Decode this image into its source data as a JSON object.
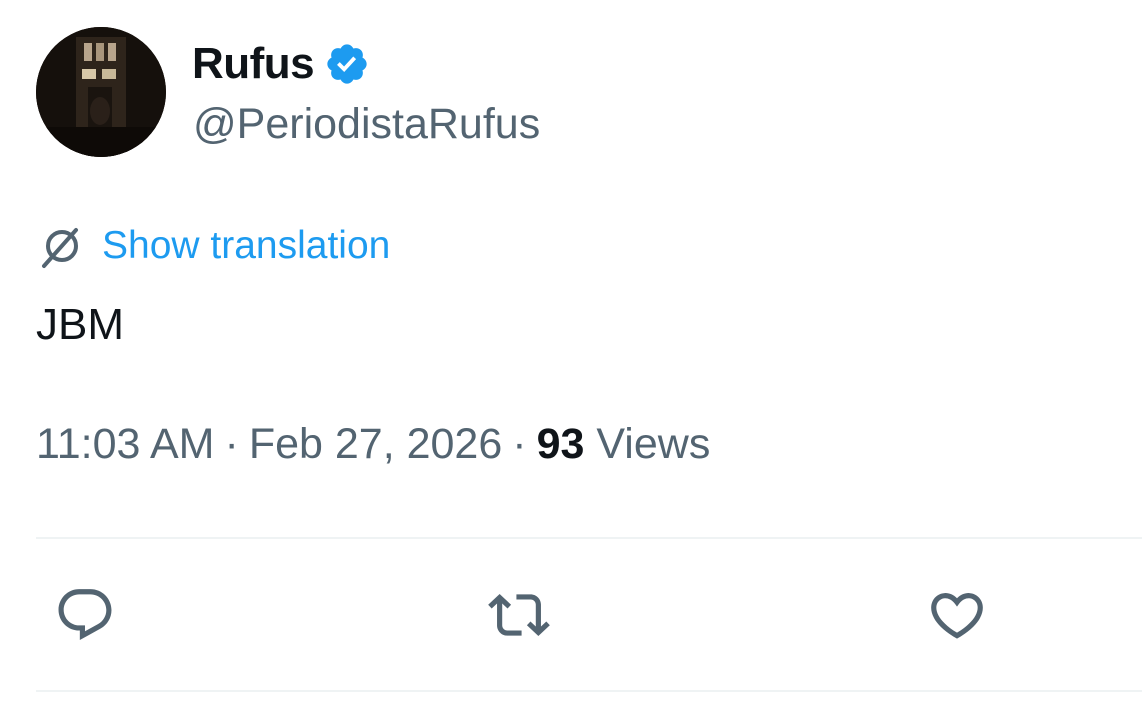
{
  "author": {
    "display_name": "Rufus",
    "handle": "@PeriodistaRufus",
    "verified": true,
    "verified_color": "#1d9bf0",
    "avatar_icon": "profile-avatar"
  },
  "translation": {
    "link_label": "Show translation",
    "icon": "translate-icon",
    "color": "#1d9bf0"
  },
  "tweet": {
    "text": "JBM"
  },
  "meta": {
    "time": "11:03 AM",
    "separator": "·",
    "date": "Feb 27, 2026",
    "views_count": "93",
    "views_label": "Views"
  },
  "actions": [
    {
      "name": "reply",
      "icon": "reply-icon"
    },
    {
      "name": "retweet",
      "icon": "retweet-icon"
    },
    {
      "name": "like",
      "icon": "heart-icon"
    }
  ],
  "colors": {
    "text_primary": "#0f1419",
    "text_secondary": "#536471",
    "accent": "#1d9bf0",
    "divider": "#eff3f4"
  }
}
